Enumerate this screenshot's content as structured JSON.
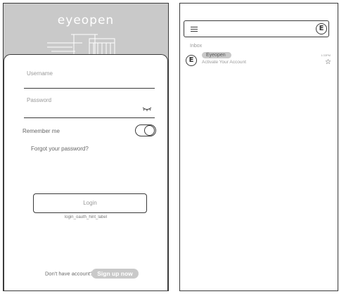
{
  "login": {
    "brand": "eyeopen",
    "username_label": "Username",
    "password_label": "Password",
    "remember_label": "Remember me",
    "remember_on": true,
    "forgot_label": "Forgot your password?",
    "login_button": "Login",
    "oauth_hint": "login_oauth_hint_label",
    "signup_prompt": "Don't have account?",
    "signup_button": "Sign up now"
  },
  "inbox": {
    "account_initial": "E",
    "heading": "Inbox",
    "messages": [
      {
        "avatar": "E",
        "sender": "Eyeopen",
        "subject": "Activate Your Account",
        "time": "1:33PM",
        "starred": false
      }
    ]
  },
  "icons": {
    "menu": "hamburger-menu-icon",
    "star": "star-outline-icon",
    "eye": "eye-closed-icon",
    "illustration": "house-icon"
  },
  "colors": {
    "header_gray": "#c9c9c9",
    "border": "#3a3a3a",
    "muted_text": "#999999"
  }
}
